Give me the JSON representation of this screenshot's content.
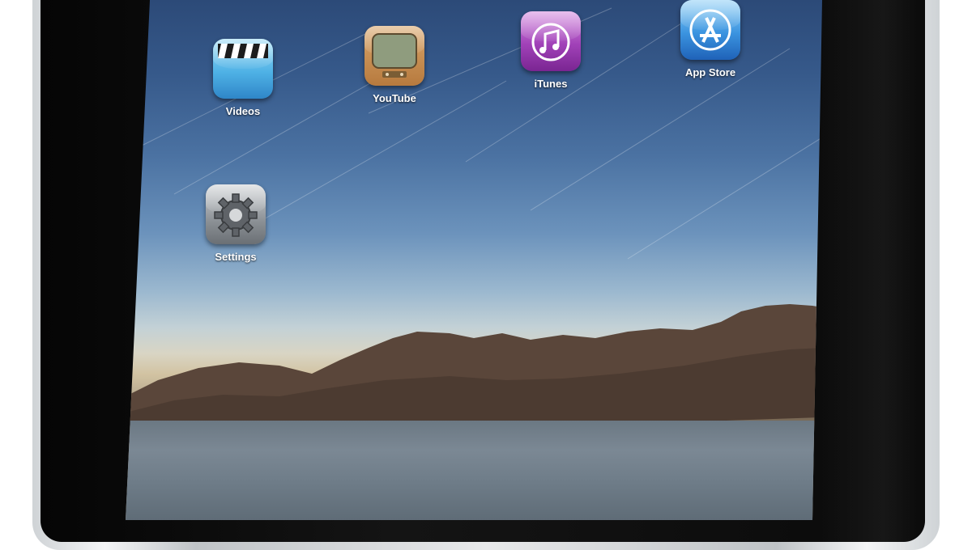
{
  "apps": [
    {
      "label": "Videos",
      "icon": "clapperboard-icon"
    },
    {
      "label": "YouTube",
      "icon": "tv-icon"
    },
    {
      "label": "iTunes",
      "icon": "music-note-icon"
    },
    {
      "label": "App Store",
      "icon": "app-store-icon"
    },
    {
      "label": "Settings",
      "icon": "gear-icon"
    }
  ]
}
